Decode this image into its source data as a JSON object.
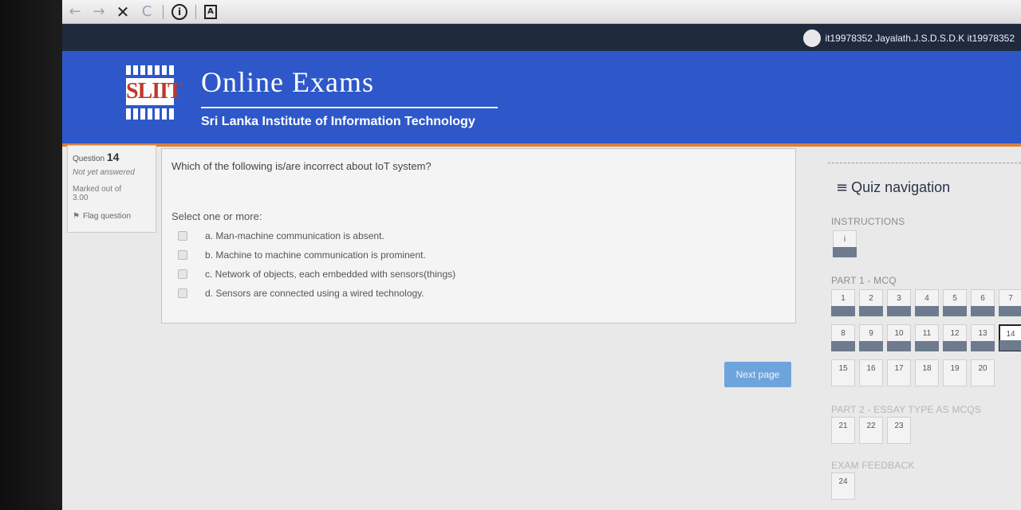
{
  "browser": {
    "back_icon": "←",
    "forward_icon": "→",
    "close_icon": "✕",
    "reload_icon": "C",
    "info_icon": "i",
    "doc_icon": "A"
  },
  "user": {
    "name": "it19978352 Jayalath.J.S.D.S.D.K it19978352"
  },
  "header": {
    "logo_text": "SLIIT",
    "title": "Online Exams",
    "subtitle": "Sri Lanka Institute of Information Technology"
  },
  "question_info": {
    "label": "Question",
    "number": "14",
    "status": "Not yet answered",
    "marked_label": "Marked out of",
    "marked_value": "3.00",
    "flag_label": "Flag question"
  },
  "question": {
    "text": "Which of the following is/are incorrect about IoT system?",
    "prompt": "Select one or more:",
    "options": [
      "a. Man-machine communication is absent.",
      "b. Machine to machine communication is prominent.",
      "c. Network of objects, each embedded with sensors(things)",
      "d. Sensors are connected using a wired technology."
    ]
  },
  "next_button": "Next page",
  "quiz_nav": {
    "menu_icon": "≡",
    "title": "Quiz navigation",
    "instructions_label": "INSTRUCTIONS",
    "instructions_button": "i",
    "part1_label": "PART 1 - MCQ",
    "part1_row1": [
      "1",
      "2",
      "3",
      "4",
      "5",
      "6",
      "7"
    ],
    "part1_row2": [
      "8",
      "9",
      "10",
      "11",
      "12",
      "13",
      "14"
    ],
    "part1_row3": [
      "15",
      "16",
      "17",
      "18",
      "19",
      "20"
    ],
    "part2_label": "PART 2 - ESSAY TYPE AS MCQS",
    "part2_row": [
      "21",
      "22",
      "23"
    ],
    "feedback_label": "EXAM FEEDBACK",
    "feedback_row": [
      "24"
    ],
    "current_question": "14"
  }
}
